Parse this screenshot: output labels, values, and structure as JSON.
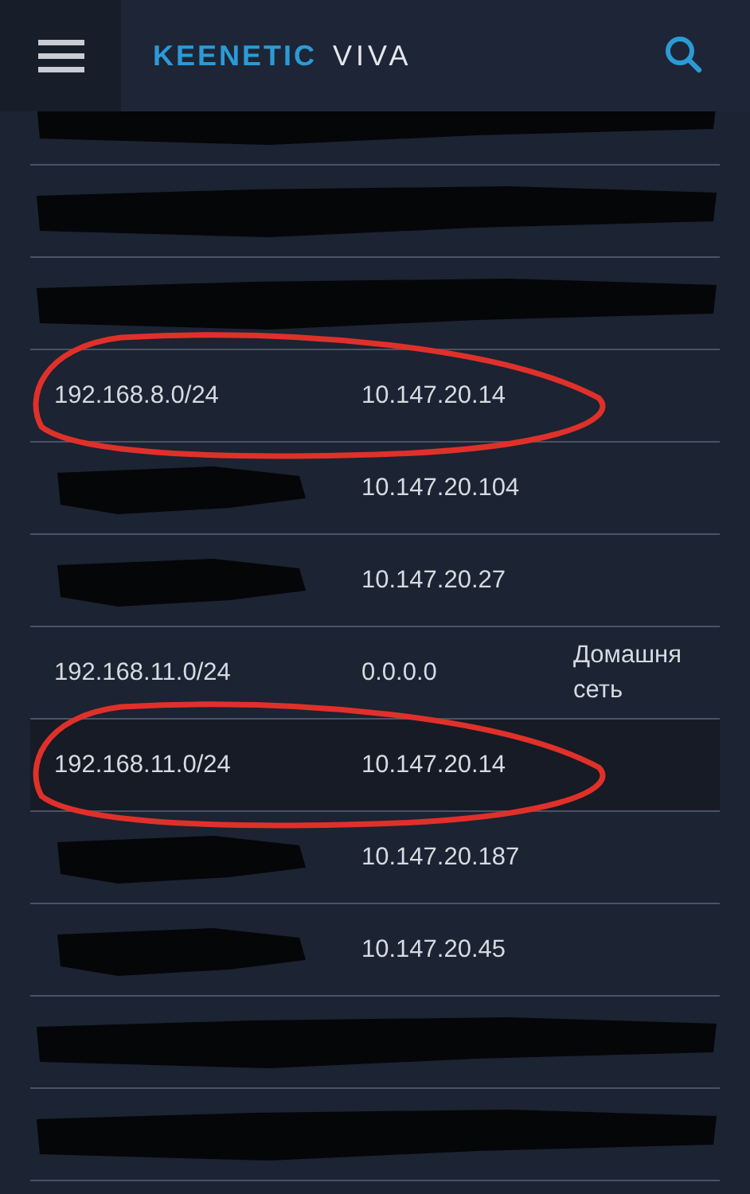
{
  "header": {
    "brand": "KEENETIC",
    "model": "VIVA"
  },
  "routes": [
    {
      "kind": "redacted",
      "selected": false,
      "circled": false
    },
    {
      "kind": "redacted",
      "selected": false,
      "circled": false
    },
    {
      "kind": "redacted",
      "selected": false,
      "circled": false
    },
    {
      "kind": "plain",
      "network": "192.168.8.0/24",
      "gateway": "10.147.20.14",
      "selected": false,
      "circled": true
    },
    {
      "kind": "partly_redacted",
      "gateway": "10.147.20.104",
      "selected": false,
      "circled": false
    },
    {
      "kind": "partly_redacted",
      "gateway": "10.147.20.27",
      "selected": false,
      "circled": false
    },
    {
      "kind": "plain",
      "network": "192.168.11.0/24",
      "gateway": "0.0.0.0",
      "interface": "Домашня сеть",
      "selected": false,
      "circled": false
    },
    {
      "kind": "plain",
      "network": "192.168.11.0/24",
      "gateway": "10.147.20.14",
      "selected": true,
      "circled": true
    },
    {
      "kind": "partly_redacted",
      "gateway": "10.147.20.187",
      "selected": false,
      "circled": false
    },
    {
      "kind": "partly_redacted",
      "gateway": "10.147.20.45",
      "selected": false,
      "circled": false
    },
    {
      "kind": "redacted",
      "selected": false,
      "circled": false
    },
    {
      "kind": "redacted",
      "selected": false,
      "circled": false
    }
  ]
}
